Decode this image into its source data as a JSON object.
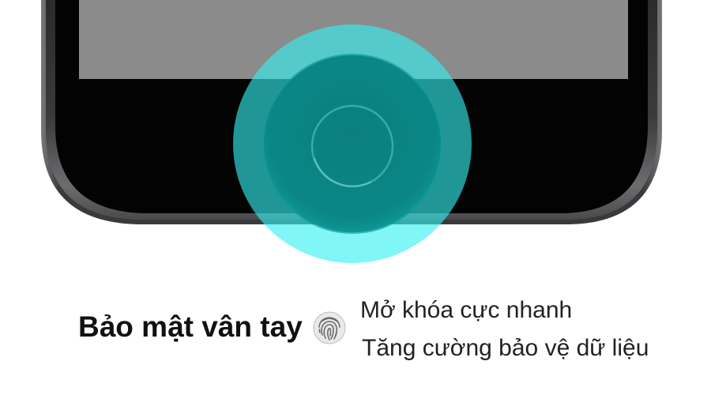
{
  "headline": {
    "title": "Bảo mật vân tay",
    "icon": "fingerprint-icon"
  },
  "features": [
    "Mở khóa cực nhanh",
    "Tăng cường bảo vệ dữ liệu"
  ],
  "colors": {
    "text": "#111111",
    "feature_text": "#222222",
    "pulse_outer": "#33f0f0",
    "pulse_inner": "#25c4c4",
    "phone_body": "#3e3e40",
    "phone_bezel": "#030303",
    "screen": "#8b8b8b"
  }
}
